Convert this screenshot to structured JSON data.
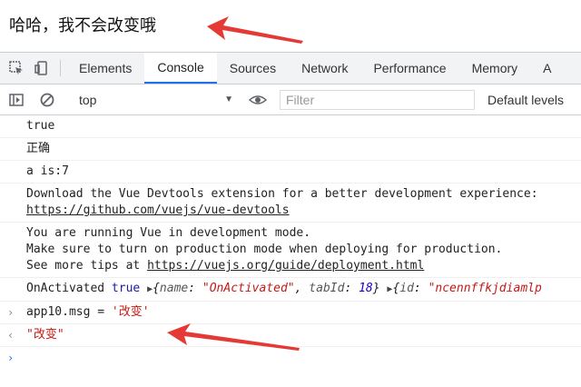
{
  "page_text": "哈哈，我不会改变哦",
  "devtools": {
    "tabs": [
      "Elements",
      "Console",
      "Sources",
      "Network",
      "Performance",
      "Memory",
      "A"
    ],
    "active_tab": "Console",
    "context": "top",
    "filter_placeholder": "Filter",
    "levels": "Default levels"
  },
  "console": {
    "line_true": "true",
    "line_correct": "正确",
    "line_a": "a is:7",
    "devtools_msg": "Download the Vue Devtools extension for a better development experience:",
    "devtools_link": "https://github.com/vuejs/vue-devtools",
    "dev_mode_1": "You are running Vue in development mode.",
    "dev_mode_2": "Make sure to turn on production mode when deploying for production.",
    "dev_mode_3": "See more tips at ",
    "dev_mode_link": "https://vuejs.org/guide/deployment.html",
    "activated_label": "OnActivated",
    "activated_bool": "true",
    "obj1_key1": "name",
    "obj1_val1": "\"OnActivated\"",
    "obj1_key2": "tabId",
    "obj1_val2": "18",
    "obj2_key1": "id",
    "obj2_val1": "\"ncennffkjdiamlp",
    "input_expr": "app10.msg = ",
    "input_str": "'改变'",
    "output": "\"改变\""
  },
  "colors": {
    "accent": "#1a73e8",
    "arrow": "#e53935",
    "string": "#c41a16",
    "keyword": "#1a1aa6"
  }
}
